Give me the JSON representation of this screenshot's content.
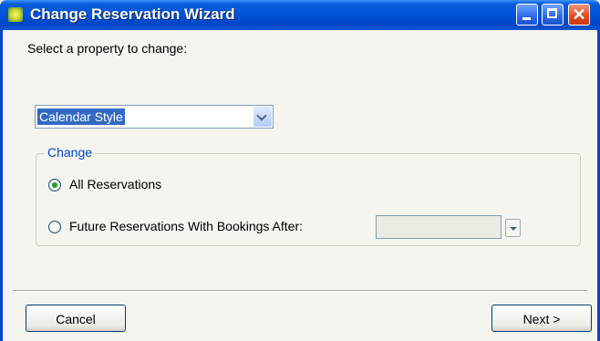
{
  "window": {
    "title": "Change Reservation Wizard",
    "icons": {
      "app": "wizard-app-icon",
      "minimize": "minimize-icon",
      "maximize": "maximize-icon",
      "close": "close-icon"
    },
    "close_glyph": "✕"
  },
  "form": {
    "prompt": "Select a property to change:",
    "property_select": {
      "selected": "Calendar Style"
    }
  },
  "change_group": {
    "legend": "Change",
    "options": [
      {
        "label": "All Reservations",
        "checked": true
      },
      {
        "label": "Future Reservations With Bookings After:",
        "checked": false
      }
    ],
    "date_value": ""
  },
  "buttons": {
    "cancel": "Cancel",
    "next": "Next >"
  },
  "colors": {
    "titlebar": "#0054e3",
    "selection": "#316ac5",
    "group_legend": "#0046d5",
    "radio_dot": "#21a121"
  }
}
